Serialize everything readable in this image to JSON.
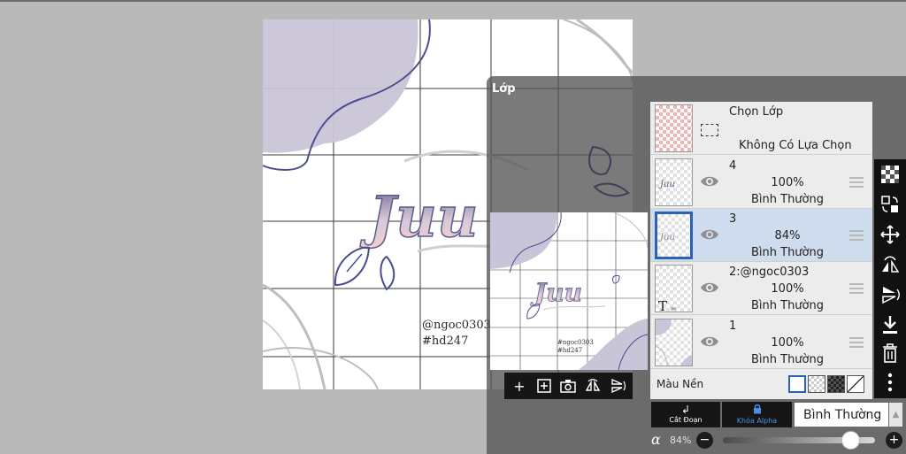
{
  "panel": {
    "title": "Lớp"
  },
  "canvas": {
    "signature_line1": "@ngoc0303",
    "signature_line2": "#hd247",
    "art_text": "Juu"
  },
  "preview": {
    "signature_line1": "#ngoc0303",
    "signature_line2": "#hd247"
  },
  "selection": {
    "title": "Chọn Lớp",
    "subtitle": "Không Có Lựa Chọn"
  },
  "layers": [
    {
      "name": "4",
      "opacity": "100%",
      "mode": "Bình Thường",
      "visible": true,
      "selected": false
    },
    {
      "name": "3",
      "opacity": "84%",
      "mode": "Bình Thường",
      "visible": true,
      "selected": true
    },
    {
      "name": "2:@ngoc0303",
      "opacity": "100%",
      "mode": "Bình Thường",
      "visible": true,
      "selected": false
    },
    {
      "name": "1",
      "opacity": "100%",
      "mode": "Bình Thường",
      "visible": true,
      "selected": false
    }
  ],
  "background": {
    "label": "Màu Nền"
  },
  "bottom": {
    "clip_label": "Cắt Đoạn",
    "alpha_lock_label": "Khóa Alpha",
    "blend_mode": "Bình Thường",
    "alpha_symbol": "α",
    "opacity_value": "84%",
    "opacity_fraction": 0.84
  },
  "colors": {
    "accent": "#2a63b3",
    "selected_row": "#cfdcee",
    "blob": "#c9c5d8",
    "stroke": "#4a4f8c"
  }
}
